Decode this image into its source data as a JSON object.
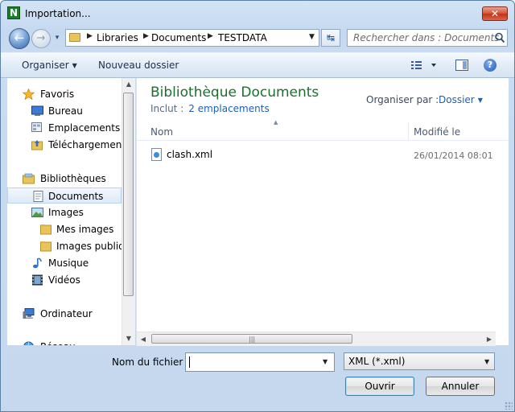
{
  "window": {
    "title": "Importation...",
    "close_label": "✕",
    "app_icon_letter": "N"
  },
  "nav": {
    "back_glyph": "←",
    "forward_glyph": "→",
    "history_glyph": "▾",
    "refresh_glyph": "↹",
    "breadcrumb": [
      "Libraries",
      "Documents",
      "TESTDATA"
    ],
    "search_placeholder": "Rechercher dans : Documents"
  },
  "toolbar": {
    "organise_label": "Organiser",
    "new_folder_label": "Nouveau dossier",
    "help_label": "?"
  },
  "navpane": {
    "items": [
      {
        "label": "Favoris",
        "icon": "star-icon",
        "selected": false
      },
      {
        "label": "Bureau",
        "icon": "desktop-icon",
        "selected": false
      },
      {
        "label": "Emplacements récents",
        "icon": "recent-places-icon",
        "selected": false
      },
      {
        "label": "Téléchargements",
        "icon": "downloads-icon",
        "selected": false
      },
      {
        "label": "Bibliothèques",
        "icon": "libraries-icon",
        "selected": false
      },
      {
        "label": "Documents",
        "icon": "documents-icon",
        "selected": true
      },
      {
        "label": "Images",
        "icon": "pictures-icon",
        "selected": false
      },
      {
        "label": "Mes images",
        "icon": "folder-icon",
        "selected": false
      },
      {
        "label": "Images publiques",
        "icon": "folder-icon",
        "selected": false
      },
      {
        "label": "Musique",
        "icon": "music-icon",
        "selected": false
      },
      {
        "label": "Vidéos",
        "icon": "videos-icon",
        "selected": false
      },
      {
        "label": "Ordinateur",
        "icon": "computer-icon",
        "selected": false
      },
      {
        "label": "Réseau",
        "icon": "network-icon",
        "selected": false
      }
    ]
  },
  "content": {
    "library_title": "Bibliothèque Documents",
    "includes_label": "Inclut :",
    "includes_link": "2 emplacements",
    "arrange_label": "Organiser par :",
    "arrange_value": "Dossier",
    "columns": {
      "name": "Nom",
      "modified": "Modifié le"
    },
    "files": [
      {
        "name": "clash.xml",
        "modified": "26/01/2014 08:01",
        "icon": "xml-file-icon"
      }
    ]
  },
  "bottom": {
    "filename_label": "Nom du fichier :",
    "filename_value": "",
    "filter_value": "XML (*.xml)",
    "open_label": "Ouvrir",
    "cancel_label": "Annuler"
  }
}
